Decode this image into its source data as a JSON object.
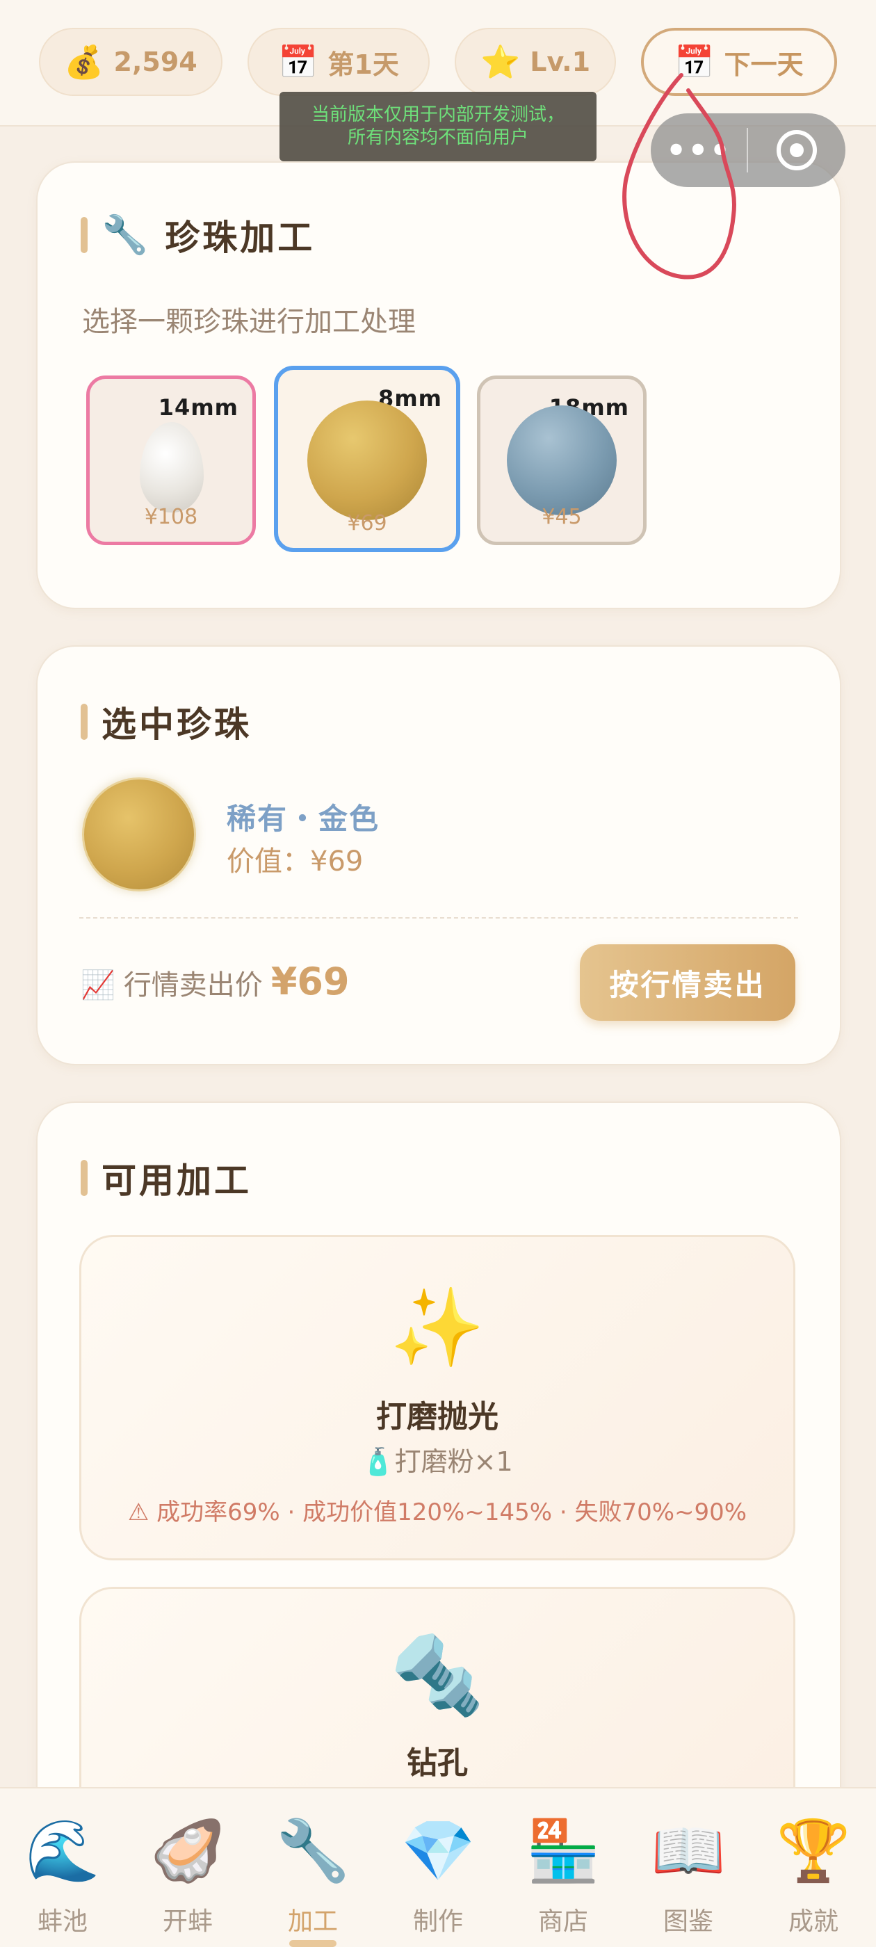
{
  "topbar": {
    "coins": {
      "icon": "money-bag-icon",
      "value": "2,594"
    },
    "day": {
      "icon": "calendar-icon",
      "label": "第1天"
    },
    "level": {
      "icon": "star-icon",
      "label": "Lv.1"
    },
    "next_day": {
      "icon": "calendar-icon",
      "label": "下一天"
    }
  },
  "notice": {
    "line1": "当前版本仅用于内部开发测试，",
    "line2": "所有内容均不面向用户"
  },
  "capsule": {
    "more": "•••"
  },
  "processing": {
    "title": "珍珠加工",
    "icon": "wrench-icon",
    "subtitle": "选择一颗珍珠进行加工处理",
    "pearls": [
      {
        "size": "14mm",
        "price": "¥108",
        "color": "#ebe8e2",
        "border": "#ec7aa3"
      },
      {
        "size": "8mm",
        "price": "¥69",
        "color": "#cfa64d",
        "border": "#5aa0ee"
      },
      {
        "size": "18mm",
        "price": "¥45",
        "color": "#7b9bb0",
        "border": "#cfc3b4"
      }
    ]
  },
  "selected": {
    "title": "选中珍珠",
    "quality": "稀有・金色",
    "value": "价值：¥69",
    "market_label": "行情卖出价",
    "market_icon": "chart-up-icon",
    "market_price": "¥69",
    "sell_button": "按行情卖出"
  },
  "available": {
    "title": "可用加工",
    "items": [
      {
        "icon": "sparkles-icon",
        "name": "打磨抛光",
        "material": "🧴打磨粉×1",
        "info": "⚠ 成功率69% · 成功价值120%~145% · 失败70%~90%"
      },
      {
        "icon": "bolt-nut-icon",
        "name": "钻孔"
      }
    ]
  },
  "tabs": [
    {
      "icon": "wave-icon",
      "label": "蚌池"
    },
    {
      "icon": "oyster-icon",
      "label": "开蚌"
    },
    {
      "icon": "wrench-icon",
      "label": "加工"
    },
    {
      "icon": "gem-icon",
      "label": "制作"
    },
    {
      "icon": "store-icon",
      "label": "商店"
    },
    {
      "icon": "book-icon",
      "label": "图鉴"
    },
    {
      "icon": "trophy-icon",
      "label": "成就"
    }
  ],
  "active_tab": "加工",
  "colors": {
    "accent": "#d3a36b",
    "background": "#f7efe6"
  }
}
